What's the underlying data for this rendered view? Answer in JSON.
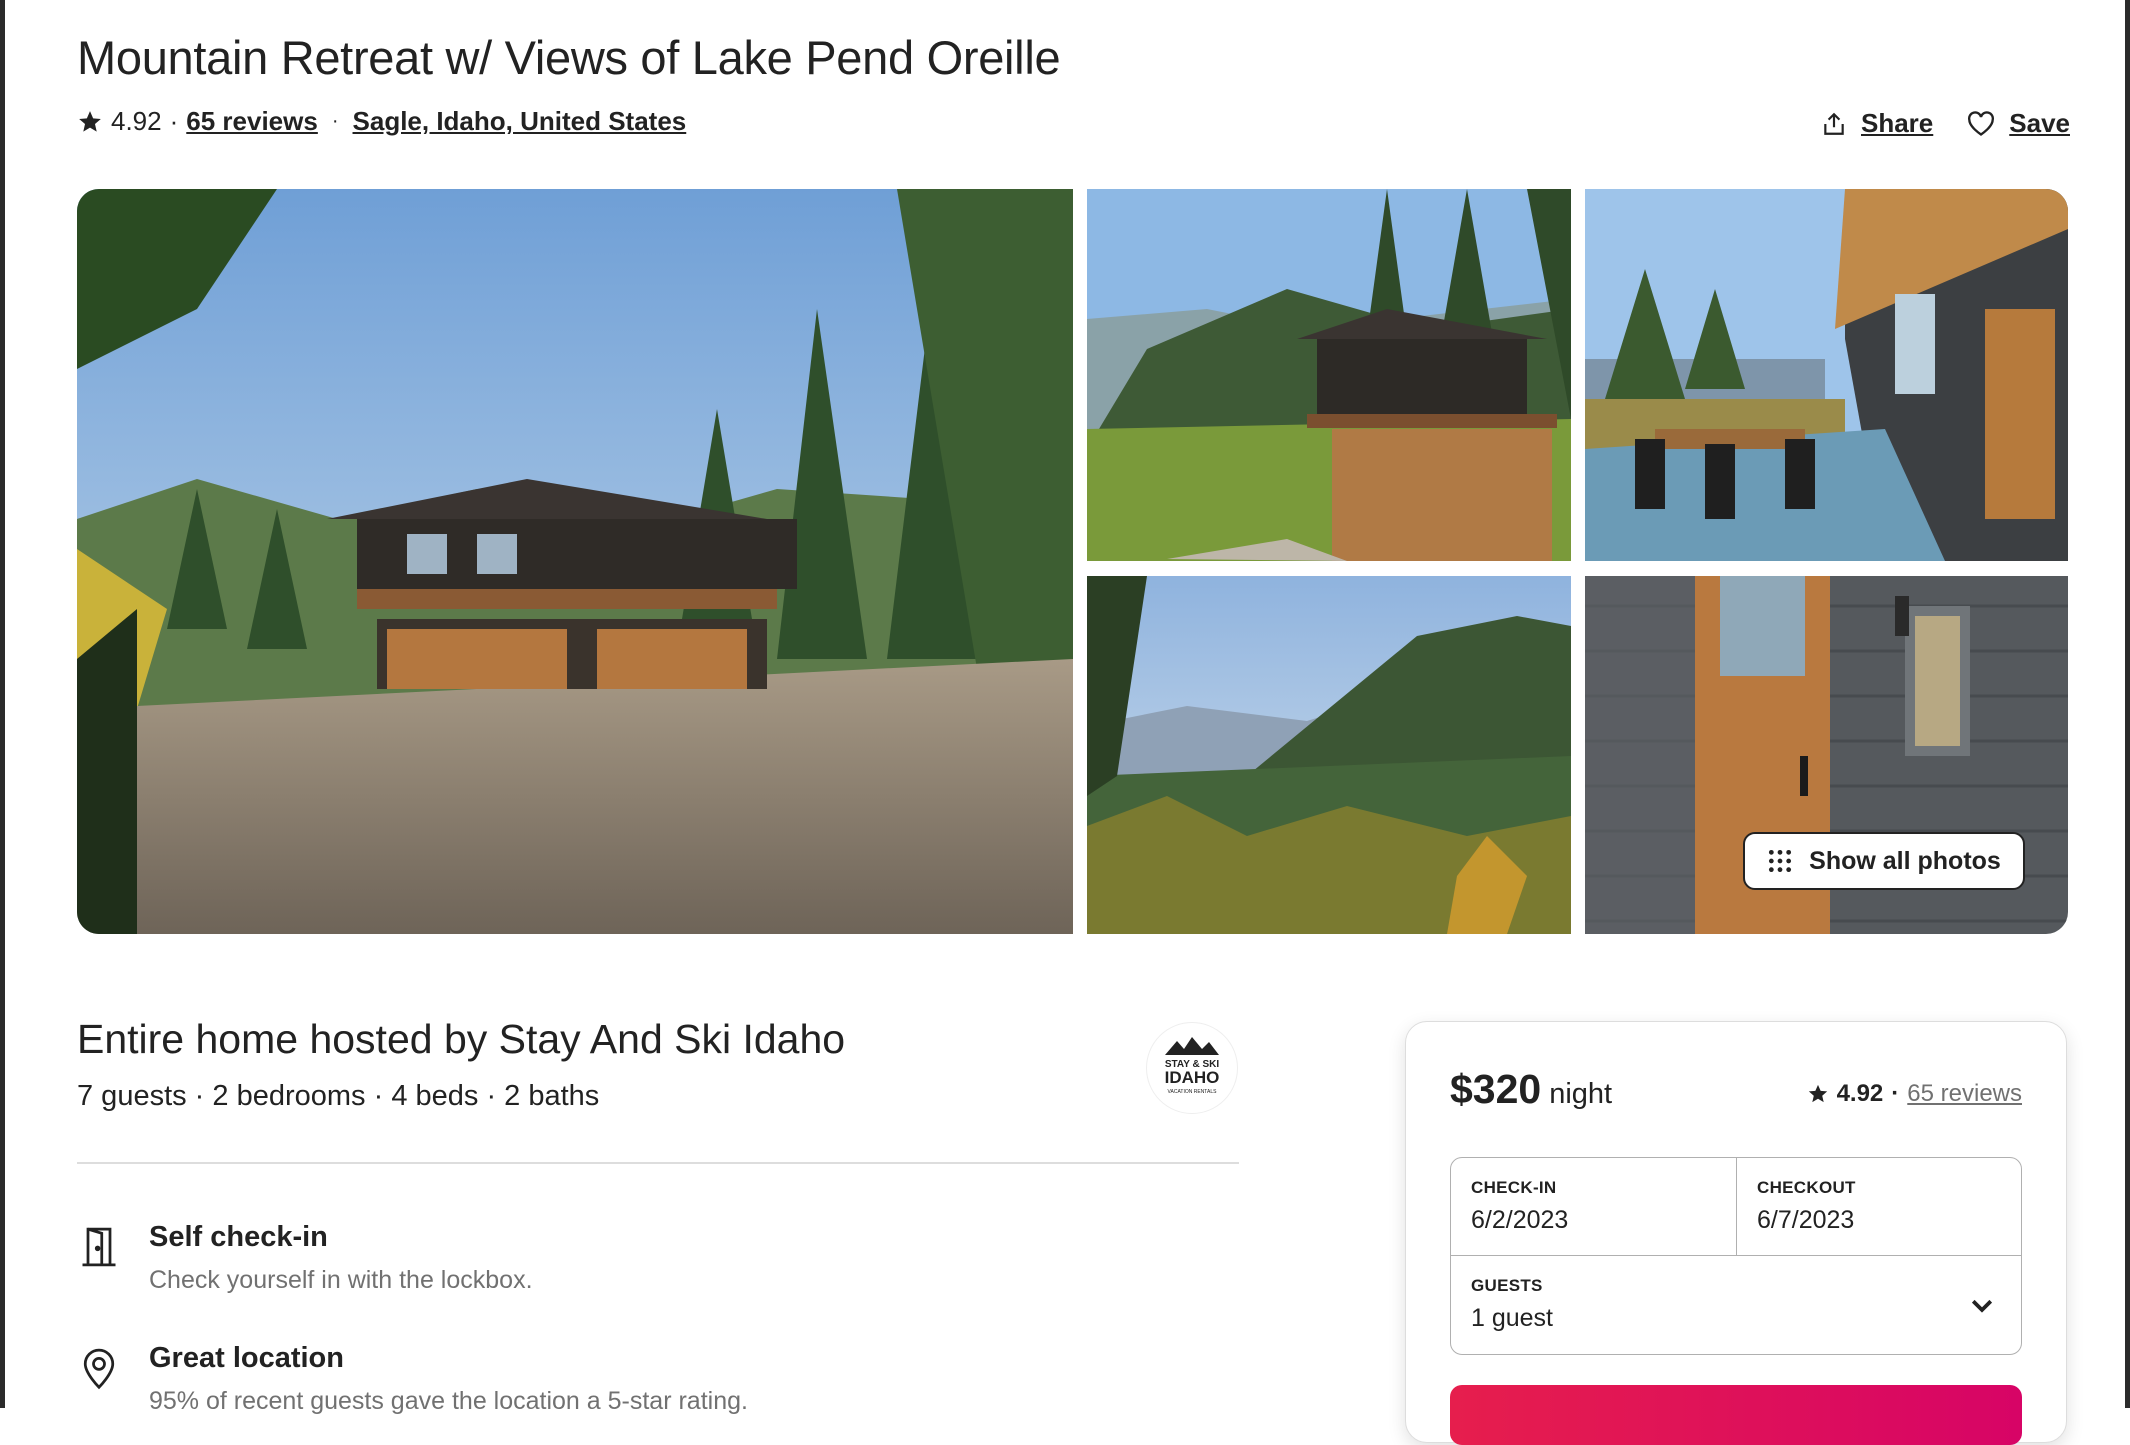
{
  "listing": {
    "title": "Mountain Retreat w/ Views of Lake Pend Oreille",
    "rating": "4.92",
    "rating_sep": "·",
    "reviews_link": "65 reviews",
    "location_sep": "·",
    "location": "Sagle, Idaho, United States"
  },
  "actions": {
    "share_label": "Share",
    "save_label": "Save"
  },
  "gallery": {
    "show_all_label": "Show all photos"
  },
  "host": {
    "title": "Entire home hosted by Stay And Ski Idaho",
    "details": "7 guests · 2 bedrooms · 4 beds · 2 baths",
    "logo_line1": "STAY & SKI",
    "logo_line2": "IDAHO",
    "logo_line3": "VACATION RENTALS"
  },
  "features": [
    {
      "icon": "door-icon",
      "title": "Self check-in",
      "description": "Check yourself in with the lockbox."
    },
    {
      "icon": "location-pin-icon",
      "title": "Great location",
      "description": "95% of recent guests gave the location a 5-star rating."
    }
  ],
  "booking": {
    "price": "$320",
    "price_unit": "night",
    "rating": "4.92",
    "rating_sep": "·",
    "reviews_link": "65 reviews",
    "checkin_label": "CHECK-IN",
    "checkin_value": "6/2/2023",
    "checkout_label": "CHECKOUT",
    "checkout_value": "6/7/2023",
    "guests_label": "GUESTS",
    "guests_value": "1 guest"
  },
  "colors": {
    "text": "#222222",
    "muted": "#717171",
    "accent": "#e61e4d",
    "border": "#dddddd"
  }
}
